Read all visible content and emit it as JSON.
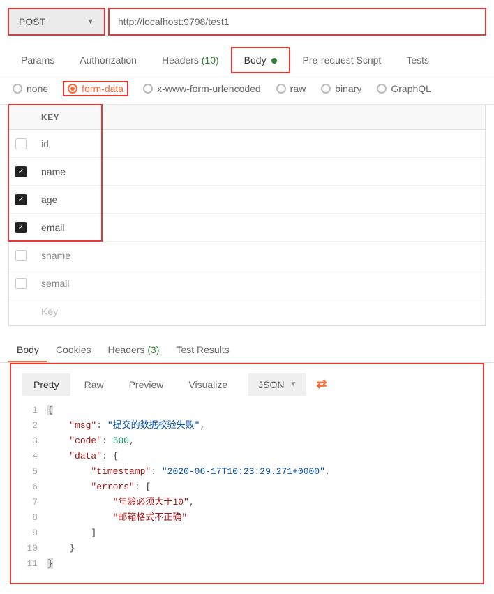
{
  "request": {
    "method": "POST",
    "url": "http://localhost:9798/test1"
  },
  "reqTabs": {
    "params": "Params",
    "auth": "Authorization",
    "headers": "Headers",
    "headersCount": "(10)",
    "body": "Body",
    "prerequest": "Pre-request Script",
    "tests": "Tests"
  },
  "bodyTypes": {
    "none": "none",
    "formdata": "form-data",
    "urlencoded": "x-www-form-urlencoded",
    "raw": "raw",
    "binary": "binary",
    "graphql": "GraphQL"
  },
  "kvHeader": {
    "key": "KEY"
  },
  "kvRows": [
    {
      "checked": false,
      "key": "id"
    },
    {
      "checked": true,
      "key": "name"
    },
    {
      "checked": true,
      "key": "age"
    },
    {
      "checked": true,
      "key": "email"
    },
    {
      "checked": false,
      "key": "sname"
    },
    {
      "checked": false,
      "key": "semail"
    }
  ],
  "kvPlaceholder": "Key",
  "respTabs": {
    "body": "Body",
    "cookies": "Cookies",
    "headers": "Headers",
    "headersCount": "(3)",
    "testresults": "Test Results"
  },
  "viewModes": {
    "pretty": "Pretty",
    "raw": "Raw",
    "preview": "Preview",
    "visualize": "Visualize",
    "lang": "JSON"
  },
  "responseJson": {
    "line1": "{",
    "line2_key": "\"msg\"",
    "line2_val": "\"提交的数据校验失败\"",
    "line3_key": "\"code\"",
    "line3_val": "500",
    "line4_key": "\"data\"",
    "line4_val": "{",
    "line5_key": "\"timestamp\"",
    "line5_val": "\"2020-06-17T10:23:29.271+0000\"",
    "line6_key": "\"errors\"",
    "line6_val": "[",
    "line7_val": "\"年龄必须大于10\"",
    "line8_val": "\"邮箱格式不正确\"",
    "line9": "]",
    "line10": "}",
    "line11": "}"
  },
  "lineNums": [
    "1",
    "2",
    "3",
    "4",
    "5",
    "6",
    "7",
    "8",
    "9",
    "10",
    "11"
  ]
}
